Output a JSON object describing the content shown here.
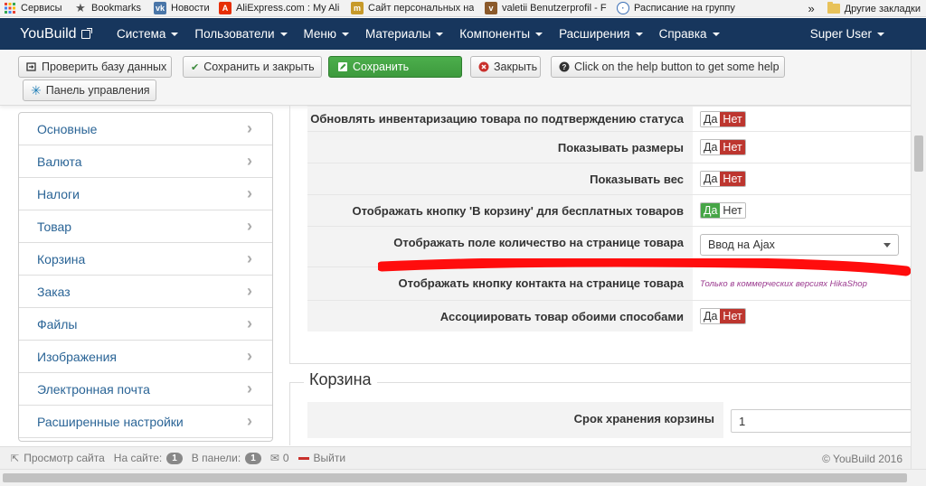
{
  "bookmarks": {
    "items": [
      {
        "label": "Сервисы",
        "icon": "apps-grid-icon",
        "color": "#e94235"
      },
      {
        "label": "Bookmarks",
        "icon": "star-icon",
        "color": "#555555"
      },
      {
        "label": "Новости",
        "icon": "vk-icon",
        "color": "#4a76a8"
      },
      {
        "label": "AliExpress.com : My Ali",
        "icon": "aliexpress-icon",
        "color": "#e62e04"
      },
      {
        "label": "Сайт персональных на",
        "icon": "site-icon",
        "color": "#c79a2a"
      },
      {
        "label": "valetii Benutzerprofil - F",
        "icon": "profile-icon",
        "color": "#8b5a2b"
      },
      {
        "label": "Расписание на группу",
        "icon": "clock-icon",
        "color": "#3b6fb6"
      }
    ],
    "more_label": "»",
    "other_label": "Другие закладки"
  },
  "navbar": {
    "brand": "YouBuild",
    "menus": [
      "Система",
      "Пользователи",
      "Меню",
      "Материалы",
      "Компоненты",
      "Расширения",
      "Справка"
    ],
    "user": "Super User"
  },
  "toolbar": {
    "check_db": "Проверить базу данных",
    "save_close": "Сохранить и закрыть",
    "save": "Сохранить",
    "close": "Закрыть",
    "help": "Click on the help button to get some help",
    "control_panel": "Панель управления"
  },
  "sidebar": {
    "items": [
      {
        "label": "Основные"
      },
      {
        "label": "Валюта"
      },
      {
        "label": "Налоги"
      },
      {
        "label": "Товар"
      },
      {
        "label": "Корзина"
      },
      {
        "label": "Заказ"
      },
      {
        "label": "Файлы"
      },
      {
        "label": "Изображения"
      },
      {
        "label": "Электронная почта"
      },
      {
        "label": "Расширенные настройки"
      }
    ]
  },
  "product_settings": {
    "rows": [
      {
        "label": "Обновлять инвентаризацию товара по подтверждению статуса",
        "value": "Нет"
      },
      {
        "label": "Показывать размеры",
        "value": "Нет"
      },
      {
        "label": "Показывать вес",
        "value": "Нет"
      },
      {
        "label": "Отображать кнопку 'В корзину' для бесплатных товаров",
        "value": "Да"
      },
      {
        "label": "Отображать поле количество на странице товара",
        "value": "Ввод на Ajax"
      },
      {
        "label": "Отображать кнопку контакта на странице товара",
        "value": "Только в коммерческих версиях HikaShop"
      },
      {
        "label": "Ассоциировать товар обоими способами",
        "value": "Нет"
      }
    ],
    "yes": "Да",
    "no": "Нет"
  },
  "cart_section": {
    "legend": "Корзина",
    "rows": [
      {
        "label": "Срок хранения корзины",
        "value": "1"
      }
    ]
  },
  "status_bar": {
    "view_site": "Просмотр сайта",
    "on_site": "На сайте:",
    "on_site_count": "1",
    "in_panel": "В панели:",
    "in_panel_count": "1",
    "messages_count": "0",
    "logout": "Выйти",
    "copyright": "© YouBuild 2016"
  },
  "colors": {
    "navbar_bg": "#17365d",
    "link": "#2a6496",
    "toggle_no_active": "#bd362f",
    "toggle_yes_active": "#46a546",
    "save_button": "#4cae4c",
    "annotation_stroke": "#ff0000"
  }
}
